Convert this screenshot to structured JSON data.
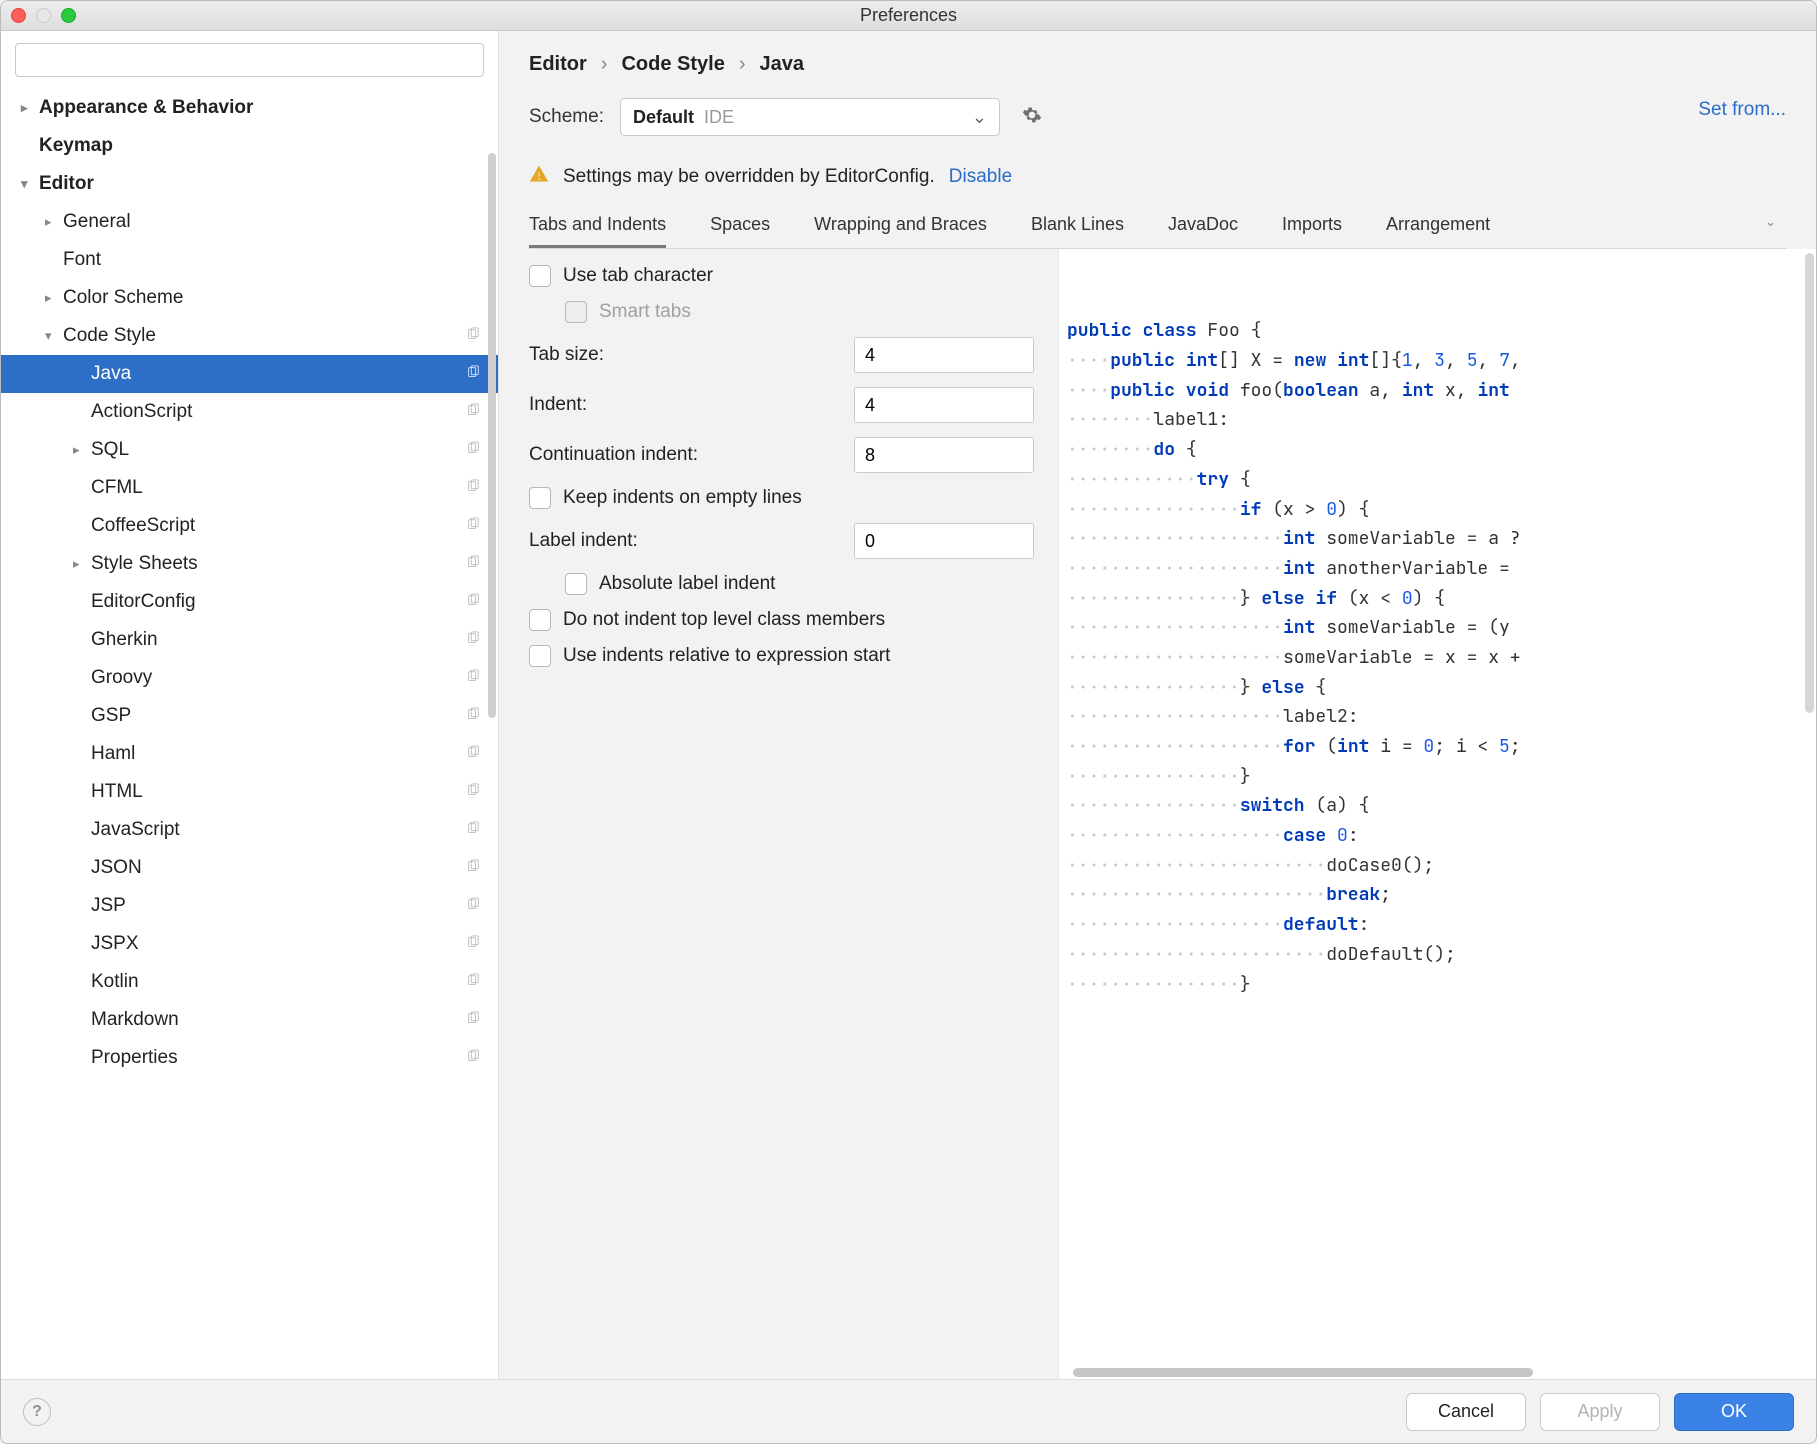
{
  "window": {
    "title": "Preferences"
  },
  "search": {
    "placeholder": ""
  },
  "sidebar": {
    "items": [
      {
        "label": "Appearance & Behavior",
        "bold": true,
        "arrow": "right",
        "depth": 0
      },
      {
        "label": "Keymap",
        "bold": true,
        "arrow": "",
        "depth": 0
      },
      {
        "label": "Editor",
        "bold": true,
        "arrow": "down",
        "depth": 0
      },
      {
        "label": "General",
        "arrow": "right",
        "depth": 1
      },
      {
        "label": "Font",
        "arrow": "",
        "depth": 1
      },
      {
        "label": "Color Scheme",
        "arrow": "right",
        "depth": 1
      },
      {
        "label": "Code Style",
        "arrow": "down",
        "depth": 1,
        "cp": true
      },
      {
        "label": "Java",
        "arrow": "",
        "depth": 2,
        "cp": true,
        "selected": true
      },
      {
        "label": "ActionScript",
        "arrow": "",
        "depth": 2,
        "cp": true
      },
      {
        "label": "SQL",
        "arrow": "right",
        "depth": 2,
        "cp": true
      },
      {
        "label": "CFML",
        "arrow": "",
        "depth": 2,
        "cp": true
      },
      {
        "label": "CoffeeScript",
        "arrow": "",
        "depth": 2,
        "cp": true
      },
      {
        "label": "Style Sheets",
        "arrow": "right",
        "depth": 2,
        "cp": true
      },
      {
        "label": "EditorConfig",
        "arrow": "",
        "depth": 2,
        "cp": true
      },
      {
        "label": "Gherkin",
        "arrow": "",
        "depth": 2,
        "cp": true
      },
      {
        "label": "Groovy",
        "arrow": "",
        "depth": 2,
        "cp": true
      },
      {
        "label": "GSP",
        "arrow": "",
        "depth": 2,
        "cp": true
      },
      {
        "label": "Haml",
        "arrow": "",
        "depth": 2,
        "cp": true
      },
      {
        "label": "HTML",
        "arrow": "",
        "depth": 2,
        "cp": true
      },
      {
        "label": "JavaScript",
        "arrow": "",
        "depth": 2,
        "cp": true
      },
      {
        "label": "JSON",
        "arrow": "",
        "depth": 2,
        "cp": true
      },
      {
        "label": "JSP",
        "arrow": "",
        "depth": 2,
        "cp": true
      },
      {
        "label": "JSPX",
        "arrow": "",
        "depth": 2,
        "cp": true
      },
      {
        "label": "Kotlin",
        "arrow": "",
        "depth": 2,
        "cp": true
      },
      {
        "label": "Markdown",
        "arrow": "",
        "depth": 2,
        "cp": true
      },
      {
        "label": "Properties",
        "arrow": "",
        "depth": 2,
        "cp": true
      }
    ]
  },
  "breadcrumb": [
    "Editor",
    "Code Style",
    "Java"
  ],
  "scheme": {
    "label": "Scheme:",
    "value": "Default",
    "hint": "IDE"
  },
  "set_from": "Set from...",
  "warning": {
    "text": "Settings may be overridden by EditorConfig.",
    "link": "Disable"
  },
  "tabs": [
    "Tabs and Indents",
    "Spaces",
    "Wrapping and Braces",
    "Blank Lines",
    "JavaDoc",
    "Imports",
    "Arrangement"
  ],
  "form": {
    "use_tab": "Use tab character",
    "smart_tabs": "Smart tabs",
    "tab_size_label": "Tab size:",
    "tab_size": "4",
    "indent_label": "Indent:",
    "indent": "4",
    "cont_label": "Continuation indent:",
    "cont": "8",
    "keep_empty": "Keep indents on empty lines",
    "label_indent_label": "Label indent:",
    "label_indent": "0",
    "abs_label": "Absolute label indent",
    "no_top": "Do not indent top level class members",
    "rel_expr": "Use indents relative to expression start"
  },
  "preview_lines": [
    {
      "pre": "",
      "segs": [
        [
          "public",
          "kw"
        ],
        [
          " ",
          ""
        ],
        [
          "class",
          "kw"
        ],
        [
          " Foo {",
          ""
        ]
      ]
    },
    {
      "pre": "····",
      "segs": [
        [
          "public",
          "kw"
        ],
        [
          " ",
          ""
        ],
        [
          "int",
          "kw"
        ],
        [
          "[] X = ",
          ""
        ],
        [
          "new",
          "kw"
        ],
        [
          " ",
          ""
        ],
        [
          "int",
          "kw"
        ],
        [
          "[]{",
          ""
        ],
        [
          "1",
          "num"
        ],
        [
          ", ",
          ""
        ],
        [
          "3",
          "num"
        ],
        [
          ", ",
          ""
        ],
        [
          "5",
          "num"
        ],
        [
          ", ",
          ""
        ],
        [
          "7",
          "num"
        ],
        [
          ",",
          ""
        ]
      ]
    },
    {
      "pre": "",
      "segs": [
        [
          "",
          ""
        ]
      ]
    },
    {
      "pre": "····",
      "segs": [
        [
          "public void",
          "kw"
        ],
        [
          " foo(",
          ""
        ],
        [
          "boolean",
          "kw"
        ],
        [
          " a, ",
          ""
        ],
        [
          "int",
          "kw"
        ],
        [
          " x, ",
          ""
        ],
        [
          "int",
          "kw"
        ],
        [
          " ",
          ""
        ]
      ]
    },
    {
      "pre": "········",
      "segs": [
        [
          "label1:",
          ""
        ]
      ]
    },
    {
      "pre": "········",
      "segs": [
        [
          "do",
          "kw"
        ],
        [
          " {",
          ""
        ]
      ]
    },
    {
      "pre": "············",
      "segs": [
        [
          "try",
          "kw"
        ],
        [
          " {",
          ""
        ]
      ]
    },
    {
      "pre": "················",
      "segs": [
        [
          "if",
          "kw"
        ],
        [
          " (x > ",
          ""
        ],
        [
          "0",
          "num"
        ],
        [
          ") {",
          ""
        ]
      ]
    },
    {
      "pre": "····················",
      "segs": [
        [
          "int",
          "kw"
        ],
        [
          " someVariable = a ?",
          ""
        ]
      ]
    },
    {
      "pre": "····················",
      "segs": [
        [
          "int",
          "kw"
        ],
        [
          " anotherVariable = ",
          ""
        ]
      ]
    },
    {
      "pre": "················",
      "segs": [
        [
          "} ",
          ""
        ],
        [
          "else if",
          "kw"
        ],
        [
          " (x < ",
          ""
        ],
        [
          "0",
          "num"
        ],
        [
          ") {",
          ""
        ]
      ]
    },
    {
      "pre": "····················",
      "segs": [
        [
          "int",
          "kw"
        ],
        [
          " someVariable = (y ",
          ""
        ]
      ]
    },
    {
      "pre": "····················",
      "segs": [
        [
          "someVariable = x = x +",
          ""
        ]
      ]
    },
    {
      "pre": "················",
      "segs": [
        [
          "} ",
          ""
        ],
        [
          "else",
          "kw"
        ],
        [
          " {",
          ""
        ]
      ]
    },
    {
      "pre": "····················",
      "segs": [
        [
          "label2:",
          ""
        ]
      ]
    },
    {
      "pre": "····················",
      "segs": [
        [
          "for",
          "kw"
        ],
        [
          " (",
          ""
        ],
        [
          "int",
          "kw"
        ],
        [
          " i = ",
          ""
        ],
        [
          "0",
          "num"
        ],
        [
          "; i < ",
          ""
        ],
        [
          "5",
          "num"
        ],
        [
          ";",
          ""
        ]
      ]
    },
    {
      "pre": "················",
      "segs": [
        [
          "}",
          ""
        ]
      ]
    },
    {
      "pre": "················",
      "segs": [
        [
          "switch",
          "kw"
        ],
        [
          " (a) {",
          ""
        ]
      ]
    },
    {
      "pre": "····················",
      "segs": [
        [
          "case",
          "kw"
        ],
        [
          " ",
          ""
        ],
        [
          "0",
          "num"
        ],
        [
          ":",
          ""
        ]
      ]
    },
    {
      "pre": "························",
      "segs": [
        [
          "doCase0();",
          ""
        ]
      ]
    },
    {
      "pre": "························",
      "segs": [
        [
          "break",
          "kw"
        ],
        [
          ";",
          ""
        ]
      ]
    },
    {
      "pre": "····················",
      "segs": [
        [
          "default",
          "kw"
        ],
        [
          ":",
          ""
        ]
      ]
    },
    {
      "pre": "························",
      "segs": [
        [
          "doDefault();",
          ""
        ]
      ]
    },
    {
      "pre": "················",
      "segs": [
        [
          "}",
          ""
        ]
      ]
    }
  ],
  "footer": {
    "cancel": "Cancel",
    "apply": "Apply",
    "ok": "OK"
  }
}
